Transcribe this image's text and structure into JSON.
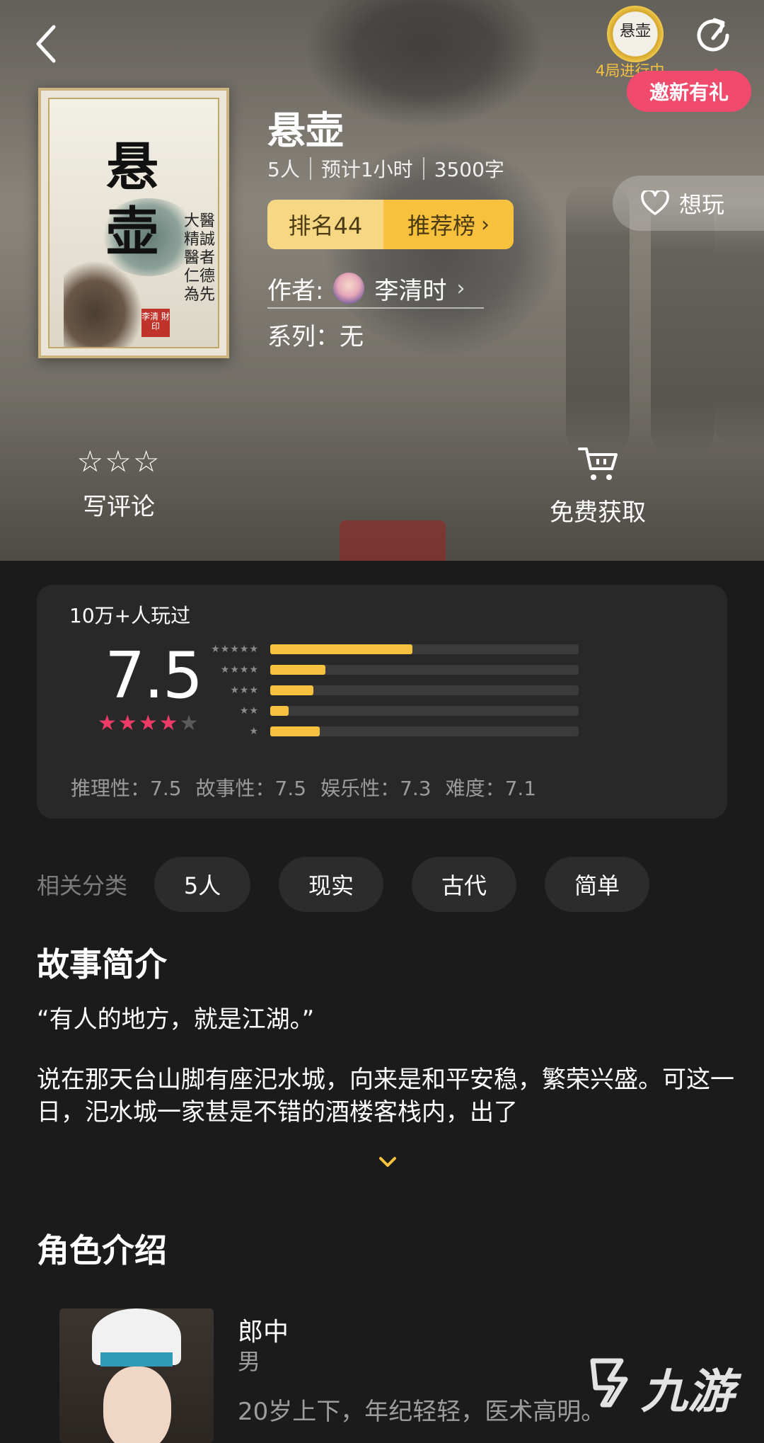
{
  "header": {
    "avatar_text": "悬壶",
    "in_progress": "4局进行中",
    "invite_badge": "邀新有礼"
  },
  "game": {
    "cover_title": "悬壶",
    "cover_vertical_text": "大醫精誠 醫者仁德為先",
    "cover_seal": "李清 財印",
    "title": "悬壶",
    "players": "5人",
    "duration": "预计1小时",
    "words": "3500字",
    "rank_label": "排名44",
    "board_label": "推荐榜",
    "want_label": "想玩",
    "author_prefix": "作者:",
    "author_name": "李清时",
    "series": "系列：无"
  },
  "actions": {
    "review_label": "写评论",
    "get_label": "免费获取"
  },
  "rating": {
    "played": "10万+人玩过",
    "score": "7.5",
    "stars_filled": 4,
    "stars_total": 5,
    "distribution": [
      {
        "stars": "★★★★★",
        "fraction": 0.46
      },
      {
        "stars": "★★★★",
        "fraction": 0.18
      },
      {
        "stars": "★★★",
        "fraction": 0.14
      },
      {
        "stars": "★★",
        "fraction": 0.06
      },
      {
        "stars": "★",
        "fraction": 0.16
      }
    ],
    "sub_scores": [
      "推理性：7.5",
      "故事性：7.5",
      "娱乐性：7.3",
      "难度：7.1"
    ]
  },
  "categories": {
    "label": "相关分类",
    "tags": [
      "5人",
      "现实",
      "古代",
      "简单"
    ]
  },
  "story": {
    "title": "故事简介",
    "quote": "“有人的地方，就是江湖。”",
    "text": "说在那天台山脚有座汜水城，向来是和平安稳，繁荣兴盛。可这一日，汜水城一家甚是不错的酒楼客栈内，出了"
  },
  "characters": {
    "title": "角色介绍",
    "items": [
      {
        "name": "郎中",
        "gender": "男",
        "desc": "20岁上下，年纪轻轻，医术高明。"
      }
    ]
  },
  "watermark": "九游",
  "colors": {
    "accent_yellow": "#f5c13e",
    "pink": "#f04a6d",
    "star_pink": "#ee3a67",
    "background": "#1b1b1b",
    "card": "#282828"
  }
}
